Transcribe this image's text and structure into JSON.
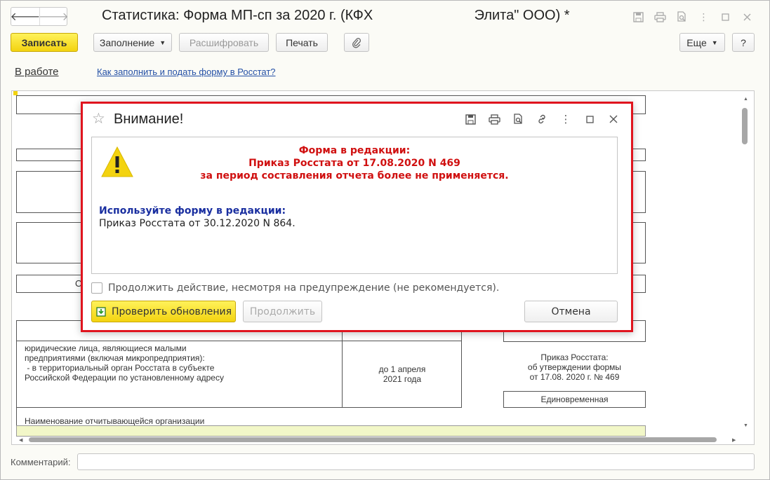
{
  "window": {
    "title": "Статистика: Форма МП-сп за 2020 г. (КФХ                          Элита\" ООО) *",
    "nav_back": "🡐",
    "nav_forward": "🡒",
    "title_icons": [
      "save-icon",
      "print-icon",
      "preview-icon",
      "more-icon",
      "maximize-icon",
      "close-icon"
    ]
  },
  "toolbar": {
    "save_label": "Записать",
    "fill_label": "Заполнение",
    "decode_label": "Расшифровать",
    "print_label": "Печать",
    "more_label": "Еще",
    "help_label": "?"
  },
  "status": {
    "state_link": "В работе",
    "help_link": "Как заполнить и подать форму в Росстат?"
  },
  "form": {
    "fragment_c": "О",
    "respondents_text": "юридические лица, являющиеся малыми\nпредприятиями (включая микропредприятия):\n - в территориальный орган Росстата в субъекте\nРоссийской Федерации по установленному адресу",
    "deadline_text": "до 1 апреля\n2021 года",
    "order_text": "Приказ Росстата:\nоб утверждении формы\nот 17.08. 2020 г. № 469",
    "periodicity": "Единовременная",
    "org_label": "Наименование отчитывающейся организации"
  },
  "comment": {
    "label": "Комментарий:",
    "value": ""
  },
  "dialog": {
    "title": "Внимание!",
    "red_line1": "Форма в редакции:",
    "red_line2": "Приказ Росстата от 17.08.2020 N 469",
    "red_line3": "за период составления отчета более не применяется.",
    "blue_line": "Используйте форму в редакции:",
    "plain_line": "Приказ Росстата от 30.12.2020 N 864.",
    "checkbox_label": "Продолжить действие, несмотря на предупреждение (не рекомендуется).",
    "check_updates_label": "Проверить обновления",
    "continue_label": "Продолжить",
    "cancel_label": "Отмена"
  },
  "colors": {
    "accent_yellow": "#f3d310",
    "dialog_border": "#e0141e",
    "warning_red": "#d01010",
    "info_blue": "#1a2fa0",
    "link_blue": "#2450a6"
  }
}
